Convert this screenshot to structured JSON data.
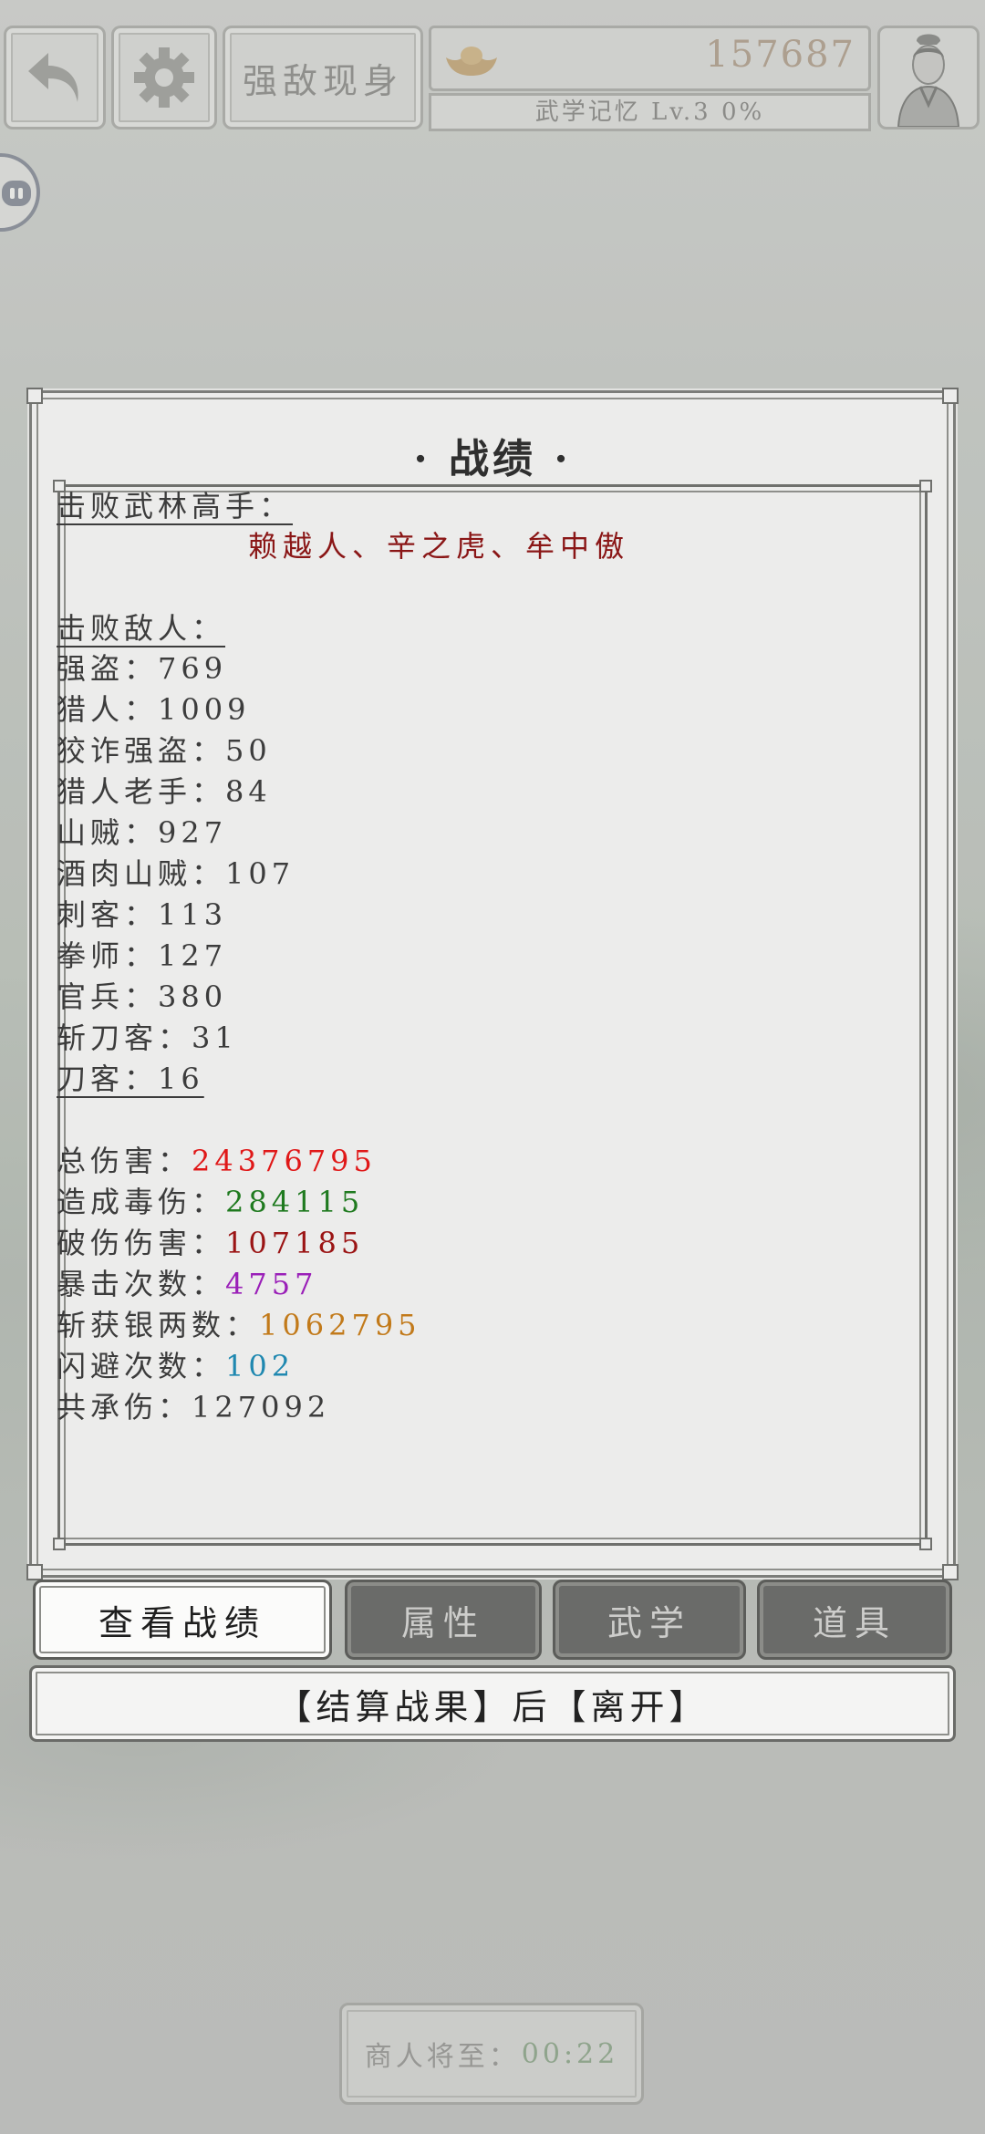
{
  "header": {
    "title_button": "强敌现身",
    "currency": "157687",
    "memory_label": "武学记忆 Lv.3 0%"
  },
  "panel": {
    "title": "· 战绩 ·",
    "masters_label": "击败武林高手：",
    "masters": "赖越人、辛之虎、牟中傲",
    "enemies_label": "击败敌人：",
    "enemies": [
      {
        "name": "强盗：",
        "count": "769"
      },
      {
        "name": "猎人：",
        "count": "1009"
      },
      {
        "name": "狡诈强盗：",
        "count": "50"
      },
      {
        "name": "猎人老手：",
        "count": "84"
      },
      {
        "name": "山贼：",
        "count": "927"
      },
      {
        "name": "酒肉山贼：",
        "count": "107"
      },
      {
        "name": "刺客：",
        "count": "113"
      },
      {
        "name": "拳师：",
        "count": "127"
      },
      {
        "name": "官兵：",
        "count": "380"
      },
      {
        "name": "斩刀客：",
        "count": "31"
      },
      {
        "name": "刀客：",
        "count": "16"
      }
    ],
    "stats": [
      {
        "label": "总伤害：",
        "value": "24376795",
        "color": "#e01818"
      },
      {
        "label": "造成毒伤：",
        "value": "284115",
        "color": "#1f7a1f"
      },
      {
        "label": "破伤伤害：",
        "value": "107185",
        "color": "#9b1414"
      },
      {
        "label": "暴击次数：",
        "value": "4757",
        "color": "#9a1fb8"
      },
      {
        "label": "斩获银两数：",
        "value": "1062795",
        "color": "#c27a1a"
      },
      {
        "label": "闪避次数：",
        "value": "102",
        "color": "#1f88b0"
      },
      {
        "label": "共承伤：",
        "value": "127092",
        "color": "#3c3c3c"
      }
    ]
  },
  "tabs": [
    "查看战绩",
    "属性",
    "武学",
    "道具"
  ],
  "settle_button": "【结算战果】后【离开】",
  "merchant": {
    "label": "商人将至：",
    "timer": "00:22"
  }
}
